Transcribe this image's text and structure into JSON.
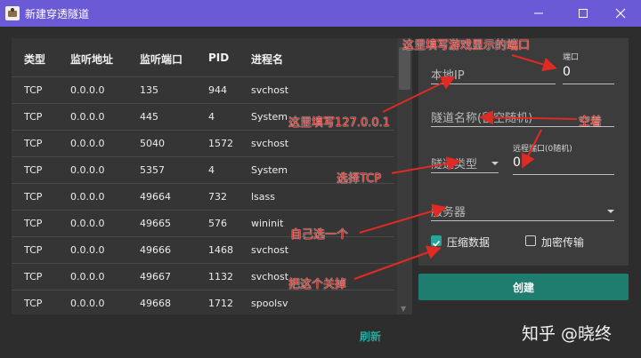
{
  "window": {
    "title": "新建穿透隧道",
    "minimize_glyph": "—",
    "maximize_glyph": "☐",
    "close_glyph": "✕",
    "icon": "app-icon",
    "titlebar_color": "#6b5ad6"
  },
  "table": {
    "headers": [
      "类型",
      "监听地址",
      "监听端口",
      "PID",
      "进程名"
    ],
    "rows": [
      [
        "TCP",
        "0.0.0.0",
        "135",
        "944",
        "svchost"
      ],
      [
        "TCP",
        "0.0.0.0",
        "445",
        "4",
        "System"
      ],
      [
        "TCP",
        "0.0.0.0",
        "5040",
        "1572",
        "svchost"
      ],
      [
        "TCP",
        "0.0.0.0",
        "5357",
        "4",
        "System"
      ],
      [
        "TCP",
        "0.0.0.0",
        "49664",
        "732",
        "lsass"
      ],
      [
        "TCP",
        "0.0.0.0",
        "49665",
        "576",
        "wininit"
      ],
      [
        "TCP",
        "0.0.0.0",
        "49666",
        "1468",
        "svchost"
      ],
      [
        "TCP",
        "0.0.0.0",
        "49667",
        "1132",
        "svchost"
      ],
      [
        "TCP",
        "0.0.0.0",
        "49668",
        "1712",
        "spoolsv"
      ]
    ],
    "refresh_label": "刷新"
  },
  "form": {
    "local_ip_placeholder": "本地IP",
    "port_label": "端口",
    "port_value": "0",
    "tunnel_name_placeholder": "隧道名称(留空随机)",
    "tunnel_type_placeholder": "隧道类型",
    "remote_port_label": "远程端口(0随机)",
    "remote_port_value": "0",
    "server_placeholder": "服务器",
    "compress_label": "压缩数据",
    "compress_checked": true,
    "encrypt_label": "加密传输",
    "encrypt_checked": false,
    "create_label": "创建",
    "accent_color": "#26a69a"
  },
  "annotations": {
    "game_port": "这里填写游戏显示的端口",
    "local_ip": "这里填写127.0.0.1",
    "leave_empty": "空着",
    "choose_tcp": "选择TCP",
    "choose_server": "自己选一个",
    "turn_off": "把这个关掉",
    "color": "#e02a24"
  },
  "watermark": "知乎 @晓终"
}
